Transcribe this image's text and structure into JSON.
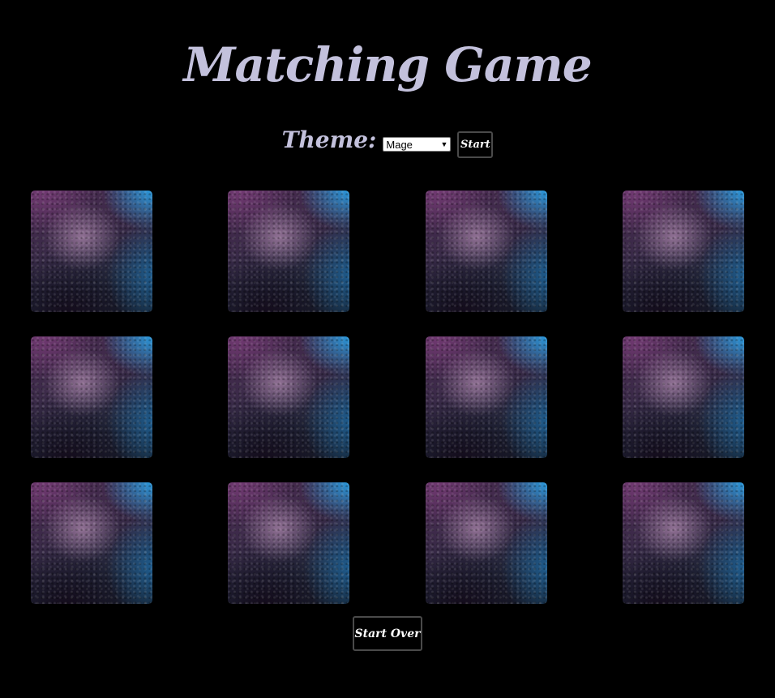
{
  "title": "Matching Game",
  "controls": {
    "theme_label": "Theme:",
    "theme_selected": "Mage",
    "start_label": "Start"
  },
  "board": {
    "rows": 3,
    "columns": 4,
    "cards_face_down": 12
  },
  "footer": {
    "start_over_label": "Start Over"
  },
  "colors": {
    "background": "#000000",
    "title_color": "#c3c1dc",
    "button_border": "#4a4a4a",
    "button_text": "#ffffff"
  },
  "icons": {
    "select_chevron": "chevron-down-icon"
  }
}
